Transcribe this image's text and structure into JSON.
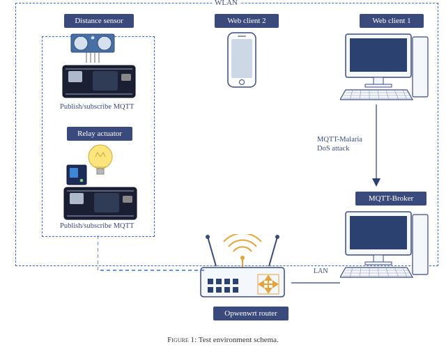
{
  "labels": {
    "wlan": "WLAN",
    "distance_sensor": "Distance sensor",
    "web_client_2": "Web client 2",
    "web_client_1": "Web client 1",
    "relay_actuator": "Relay actuator",
    "mqtt_broker": "MQTT-Broker",
    "openwrt_router": "Opwenwrt router",
    "lan": "LAN",
    "pub_sub": "Publish/subscribe MQTT",
    "attack_line1": "MQTT-Malaria",
    "attack_line2": "DoS attack"
  },
  "caption_prefix": "Figure 1: ",
  "caption_text": "Test environment schema."
}
